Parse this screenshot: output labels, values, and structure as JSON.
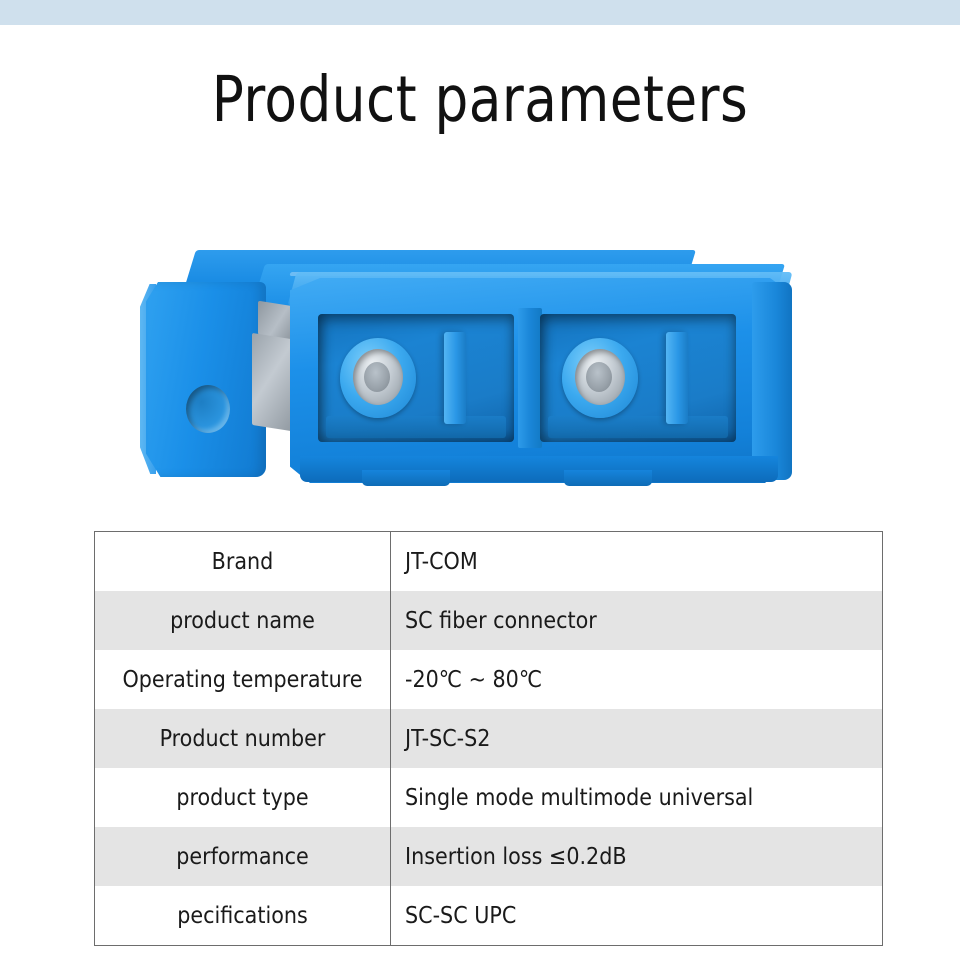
{
  "page": {
    "title": "Product parameters",
    "band_color": "#cfe0ed",
    "background": "#ffffff"
  },
  "product_image": {
    "alt": "Blue duplex SC fiber optic adapter coupler shown at an angle",
    "body_color": "#1a8ce4",
    "ferrule_color": "#c4ccd3",
    "port_count": 2
  },
  "parameters_table": {
    "rows": [
      {
        "label": "Brand",
        "value": "JT-COM"
      },
      {
        "label": "product name",
        "value": "SC fiber connector"
      },
      {
        "label": "Operating temperature",
        "value": "-20℃ ~ 80℃"
      },
      {
        "label": "Product number",
        "value": "JT-SC-S2"
      },
      {
        "label": "product type",
        "value": "Single mode multimode universal"
      },
      {
        "label": "performance",
        "value": "Insertion loss ≤0.2dB"
      },
      {
        "label": "pecifications",
        "value": "SC-SC UPC"
      }
    ]
  }
}
